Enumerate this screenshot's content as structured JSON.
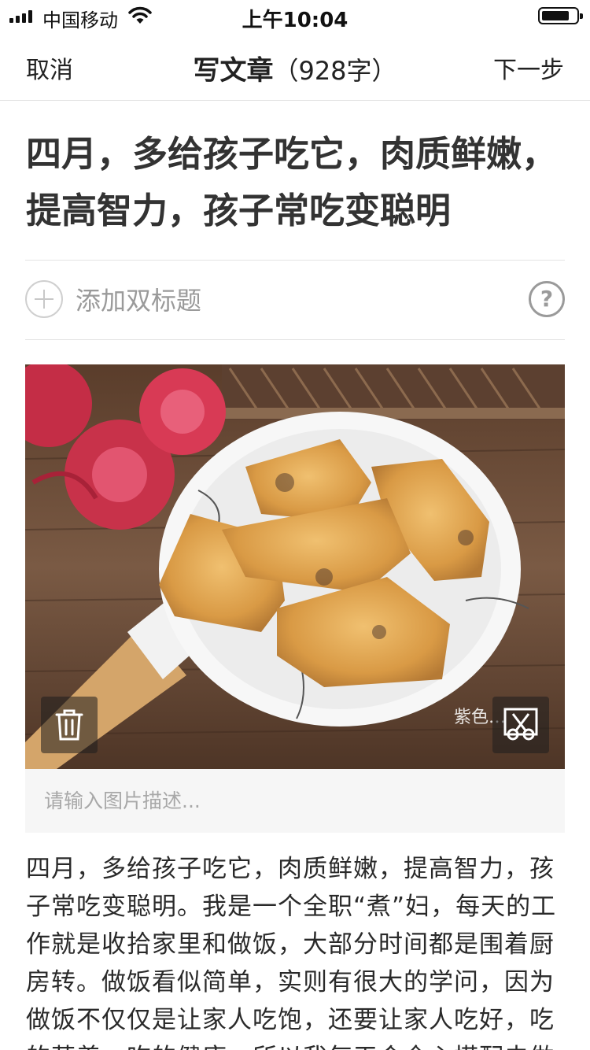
{
  "status_bar": {
    "carrier": "中国移动",
    "time": "上午10:04",
    "icons": [
      "signal-icon",
      "wifi-icon",
      "battery-icon"
    ]
  },
  "nav": {
    "cancel_label": "取消",
    "title": "写文章",
    "word_count": "（928字）",
    "next_label": "下一步"
  },
  "article": {
    "title": "四月，多给孩子吃它，肉质鲜嫩，提高智力，孩子常吃变聪明",
    "add_subtitle_label": "添加双标题",
    "help_symbol": "?",
    "image": {
      "watermark": "紫色…",
      "caption_placeholder": "请输入图片描述...",
      "delete_icon": "trash-icon",
      "crop_icon": "crop-icon"
    },
    "body": "四月，多给孩子吃它，肉质鲜嫩，提高智力，孩子常吃变聪明。我是一个全职“煮”妇，每天的工作就是收拾家里和做饭，大部分时间都是围着厨房转。做饭看似简单，实则有很大的学问，因为做饭不仅仅是让家人吃饱，还要让家人吃好，吃的营养，吃的健康，所以我每天会全心搭配去做"
  }
}
